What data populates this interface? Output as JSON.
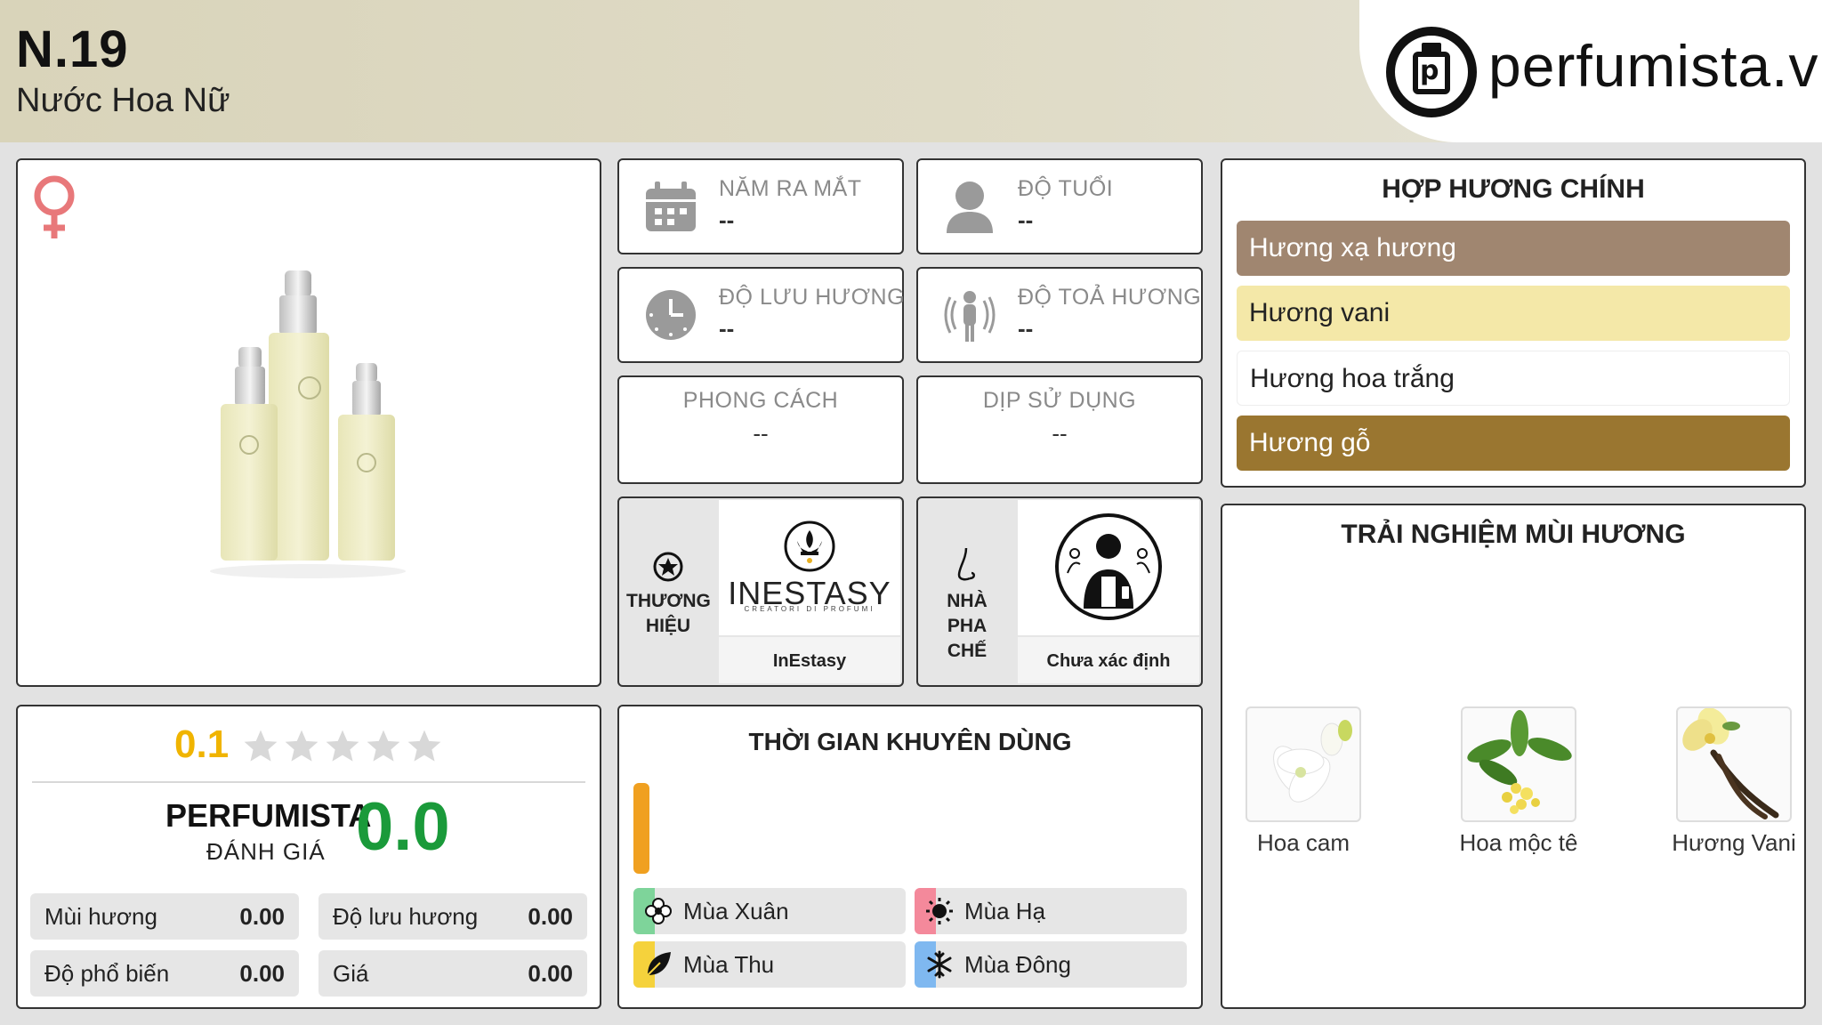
{
  "header": {
    "title": "N.19",
    "subtitle": "Nước Hoa Nữ",
    "logo_text": "perfumista.vn"
  },
  "info_cards": {
    "release_year": {
      "label": "NĂM RA MẮT",
      "value": "--"
    },
    "age": {
      "label": "ĐỘ TUỔI",
      "value": "--"
    },
    "longevity": {
      "label": "ĐỘ LƯU HƯƠNG",
      "value": "--"
    },
    "sillage": {
      "label": "ĐỘ TOẢ HƯƠNG",
      "value": "--"
    },
    "style": {
      "label": "PHONG CÁCH",
      "value": "--"
    },
    "occasion": {
      "label": "DỊP SỬ DỤNG",
      "value": "--"
    }
  },
  "brand": {
    "label_line1": "THƯƠNG",
    "label_line2": "HIỆU",
    "logo_main": "INESTASY",
    "logo_sub": "CREATORI DI PROFUMI",
    "name": "InEstasy"
  },
  "perfumer": {
    "label_line1": "NHÀ PHA",
    "label_line2": "CHẾ",
    "name": "Chưa xác định"
  },
  "accords": {
    "title": "HỢP HƯƠNG CHÍNH",
    "items": [
      {
        "label": "Hương xạ hương",
        "color": "#a08670",
        "text_color": "#ffffff"
      },
      {
        "label": "Hương vani",
        "color": "#f4e8a8",
        "text_color": "#222222"
      },
      {
        "label": "Hương hoa trắng",
        "color": "#ffffff",
        "text_color": "#222222"
      },
      {
        "label": "Hương gỗ",
        "color": "#9a7630",
        "text_color": "#ffffff"
      }
    ]
  },
  "experience": {
    "title": "TRẢI NGHIỆM MÙI HƯƠNG",
    "notes": [
      {
        "label": "Hoa cam"
      },
      {
        "label": "Hoa mộc tê"
      },
      {
        "label": "Hương Vani"
      }
    ]
  },
  "rating": {
    "score": "0.1",
    "stars_filled": 0,
    "stars_total": 5,
    "perfumista_label": "PERFUMISTA",
    "perfumista_sub": "ĐÁNH GIÁ",
    "perfumista_score": "0.0",
    "rows": [
      {
        "label": "Mùi hương",
        "value": "0.00"
      },
      {
        "label": "Độ lưu hương",
        "value": "0.00"
      },
      {
        "label": "Độ phổ biến",
        "value": "0.00"
      },
      {
        "label": "Giá",
        "value": "0.00"
      }
    ],
    "score_color": "#f0b400",
    "perfumista_color": "#1a9a3a"
  },
  "timing": {
    "title": "THỜI GIAN KHUYÊN DÙNG",
    "day_night_bar_color": "#f0a020",
    "seasons": [
      {
        "label": "Mùa Xuân",
        "color": "#7ed49a"
      },
      {
        "label": "Mùa Hạ",
        "color": "#f4899b"
      },
      {
        "label": "Mùa Thu",
        "color": "#f5d23c"
      },
      {
        "label": "Mùa Đông",
        "color": "#7fb8f0"
      }
    ]
  }
}
